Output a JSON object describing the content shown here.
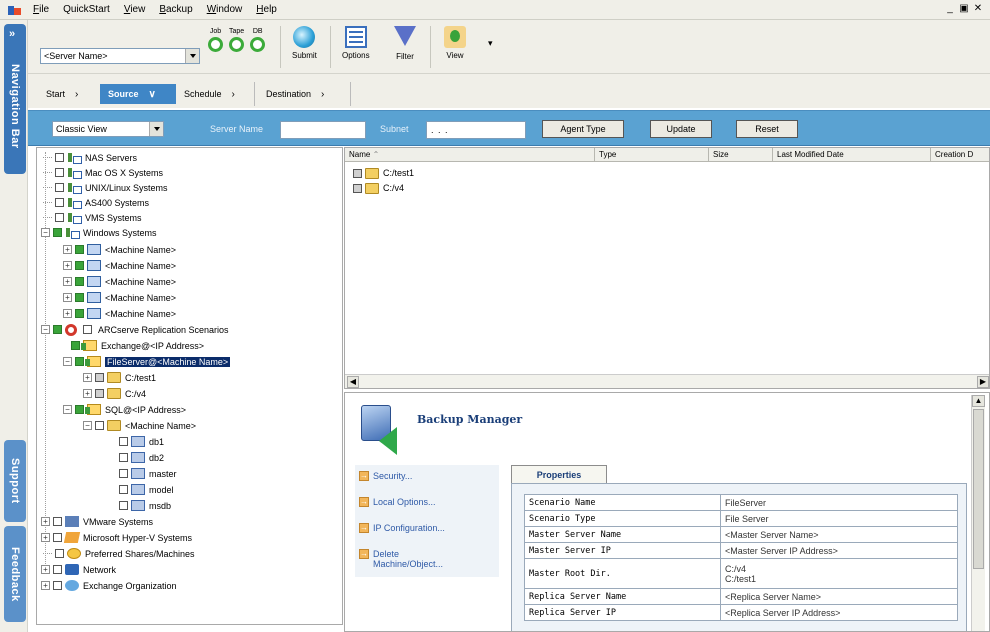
{
  "menu": {
    "items": [
      {
        "u": "F",
        "rest": "ile"
      },
      {
        "u": "",
        "rest": "QuickStart"
      },
      {
        "u": "V",
        "rest": "iew"
      },
      {
        "u": "B",
        "rest": "ackup"
      },
      {
        "u": "W",
        "rest": "indow"
      },
      {
        "u": "H",
        "rest": "elp"
      }
    ]
  },
  "nav": {
    "navigation_bar": "Navigation Bar",
    "support": "Support",
    "feedback": "Feedback"
  },
  "toolbar": {
    "server_combo": "<Server Name>",
    "lights": [
      "Job",
      "Tape",
      "DB"
    ],
    "submit": "Submit",
    "options": "Options",
    "filter": "Filter",
    "view": "View"
  },
  "wizard": {
    "tabs": [
      "Start",
      "Source",
      "Schedule",
      "Destination"
    ]
  },
  "filterbar": {
    "view_combo": "Classic View",
    "server_name_label": "Server Name",
    "server_name_value": "",
    "subnet_label": "Subnet",
    "subnet_value": "  .  .  .  ",
    "agent_type": "Agent Type",
    "update": "Update",
    "reset": "Reset"
  },
  "tree": {
    "nas": "NAS Servers",
    "mac": "Mac OS X Systems",
    "unix": "UNIX/Linux Systems",
    "as400": "AS400 Systems",
    "vms": "VMS Systems",
    "windows": "Windows Systems",
    "machine1": "<Machine Name>",
    "machine2": "<Machine Name>",
    "machine3": "<Machine Name>",
    "machine4": "<Machine Name>",
    "machine5": "<Machine Name>",
    "replication": "ARCserve Replication Scenarios",
    "exchange": "Exchange@<IP Address>",
    "fileserver": "FileServer@<Machine Name>",
    "test1": "C:/test1",
    "v4": "C:/v4",
    "sql": "SQL@<IP Address>",
    "sql_machine": "<Machine Name>",
    "db1": "db1",
    "db2": "db2",
    "master": "master",
    "model": "model",
    "msdb": "msdb",
    "vmware": "VMware Systems",
    "hyperv": "Microsoft Hyper-V Systems",
    "preferred": "Preferred Shares/Machines",
    "network": "Network",
    "exchange_org": "Exchange Organization"
  },
  "list": {
    "headers": [
      "Name",
      "Type",
      "Size",
      "Last Modified Date",
      "Creation D"
    ],
    "rows": [
      "C:/test1",
      "C:/v4"
    ]
  },
  "manager": {
    "title": "Backup Manager",
    "links": [
      "Security...",
      "Local Options...",
      "IP Configuration...",
      "Delete",
      "Machine/Object..."
    ],
    "properties_tab": "Properties",
    "props": [
      [
        "Scenario Name",
        "FileServer"
      ],
      [
        "Scenario Type",
        "File Server"
      ],
      [
        "Master Server Name",
        "<Master Server Name>"
      ],
      [
        "Master Server IP",
        "<Master Server IP Address>"
      ],
      [
        "Master Root Dir.",
        "C:/v4"
      ],
      [
        "",
        "C:/test1"
      ],
      [
        "Replica Server Name",
        "<Replica Server Name>"
      ],
      [
        "Replica Server IP",
        "<Replica Server IP Address>"
      ]
    ]
  },
  "colors": {
    "accent_blue": "#5aa2d2",
    "nav_tab": "#3a76b8",
    "selection": "#0b2c6a",
    "status_green": "#3cab3a"
  }
}
